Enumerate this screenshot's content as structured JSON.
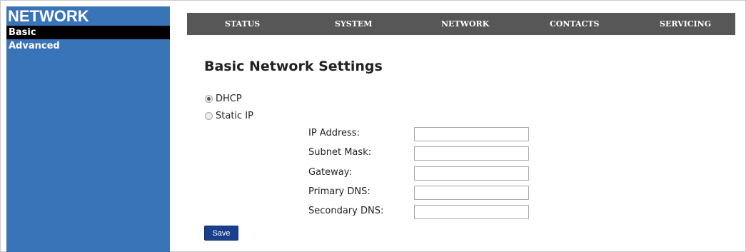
{
  "sidebar": {
    "title": "NETWORK",
    "items": [
      {
        "label": "Basic",
        "active": true
      },
      {
        "label": "Advanced",
        "active": false
      }
    ]
  },
  "topnav": {
    "items": [
      "STATUS",
      "SYSTEM",
      "NETWORK",
      "CONTACTS",
      "SERVICING"
    ]
  },
  "main": {
    "heading": "Basic Network Settings",
    "mode": {
      "options": [
        {
          "label": "DHCP",
          "checked": true
        },
        {
          "label": "Static IP",
          "checked": false
        }
      ]
    },
    "fields": [
      {
        "label": "IP Address:",
        "value": ""
      },
      {
        "label": "Subnet Mask:",
        "value": ""
      },
      {
        "label": "Gateway:",
        "value": ""
      },
      {
        "label": "Primary DNS:",
        "value": ""
      },
      {
        "label": "Secondary DNS:",
        "value": ""
      }
    ],
    "save_label": "Save"
  },
  "colors": {
    "sidebar_bg": "#3a74b8",
    "topnav_bg": "#575757",
    "save_bg": "#1a3f8c"
  }
}
